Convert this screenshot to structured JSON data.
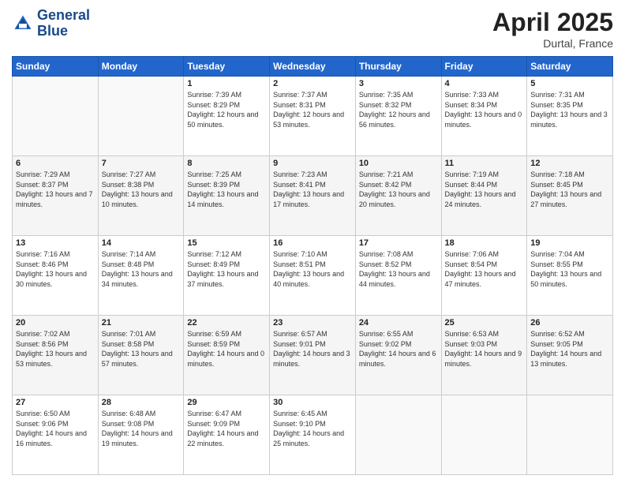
{
  "header": {
    "logo_line1": "General",
    "logo_line2": "Blue",
    "month": "April 2025",
    "location": "Durtal, France"
  },
  "weekdays": [
    "Sunday",
    "Monday",
    "Tuesday",
    "Wednesday",
    "Thursday",
    "Friday",
    "Saturday"
  ],
  "weeks": [
    [
      {
        "day": "",
        "info": ""
      },
      {
        "day": "",
        "info": ""
      },
      {
        "day": "1",
        "info": "Sunrise: 7:39 AM\nSunset: 8:29 PM\nDaylight: 12 hours and 50 minutes."
      },
      {
        "day": "2",
        "info": "Sunrise: 7:37 AM\nSunset: 8:31 PM\nDaylight: 12 hours and 53 minutes."
      },
      {
        "day": "3",
        "info": "Sunrise: 7:35 AM\nSunset: 8:32 PM\nDaylight: 12 hours and 56 minutes."
      },
      {
        "day": "4",
        "info": "Sunrise: 7:33 AM\nSunset: 8:34 PM\nDaylight: 13 hours and 0 minutes."
      },
      {
        "day": "5",
        "info": "Sunrise: 7:31 AM\nSunset: 8:35 PM\nDaylight: 13 hours and 3 minutes."
      }
    ],
    [
      {
        "day": "6",
        "info": "Sunrise: 7:29 AM\nSunset: 8:37 PM\nDaylight: 13 hours and 7 minutes."
      },
      {
        "day": "7",
        "info": "Sunrise: 7:27 AM\nSunset: 8:38 PM\nDaylight: 13 hours and 10 minutes."
      },
      {
        "day": "8",
        "info": "Sunrise: 7:25 AM\nSunset: 8:39 PM\nDaylight: 13 hours and 14 minutes."
      },
      {
        "day": "9",
        "info": "Sunrise: 7:23 AM\nSunset: 8:41 PM\nDaylight: 13 hours and 17 minutes."
      },
      {
        "day": "10",
        "info": "Sunrise: 7:21 AM\nSunset: 8:42 PM\nDaylight: 13 hours and 20 minutes."
      },
      {
        "day": "11",
        "info": "Sunrise: 7:19 AM\nSunset: 8:44 PM\nDaylight: 13 hours and 24 minutes."
      },
      {
        "day": "12",
        "info": "Sunrise: 7:18 AM\nSunset: 8:45 PM\nDaylight: 13 hours and 27 minutes."
      }
    ],
    [
      {
        "day": "13",
        "info": "Sunrise: 7:16 AM\nSunset: 8:46 PM\nDaylight: 13 hours and 30 minutes."
      },
      {
        "day": "14",
        "info": "Sunrise: 7:14 AM\nSunset: 8:48 PM\nDaylight: 13 hours and 34 minutes."
      },
      {
        "day": "15",
        "info": "Sunrise: 7:12 AM\nSunset: 8:49 PM\nDaylight: 13 hours and 37 minutes."
      },
      {
        "day": "16",
        "info": "Sunrise: 7:10 AM\nSunset: 8:51 PM\nDaylight: 13 hours and 40 minutes."
      },
      {
        "day": "17",
        "info": "Sunrise: 7:08 AM\nSunset: 8:52 PM\nDaylight: 13 hours and 44 minutes."
      },
      {
        "day": "18",
        "info": "Sunrise: 7:06 AM\nSunset: 8:54 PM\nDaylight: 13 hours and 47 minutes."
      },
      {
        "day": "19",
        "info": "Sunrise: 7:04 AM\nSunset: 8:55 PM\nDaylight: 13 hours and 50 minutes."
      }
    ],
    [
      {
        "day": "20",
        "info": "Sunrise: 7:02 AM\nSunset: 8:56 PM\nDaylight: 13 hours and 53 minutes."
      },
      {
        "day": "21",
        "info": "Sunrise: 7:01 AM\nSunset: 8:58 PM\nDaylight: 13 hours and 57 minutes."
      },
      {
        "day": "22",
        "info": "Sunrise: 6:59 AM\nSunset: 8:59 PM\nDaylight: 14 hours and 0 minutes."
      },
      {
        "day": "23",
        "info": "Sunrise: 6:57 AM\nSunset: 9:01 PM\nDaylight: 14 hours and 3 minutes."
      },
      {
        "day": "24",
        "info": "Sunrise: 6:55 AM\nSunset: 9:02 PM\nDaylight: 14 hours and 6 minutes."
      },
      {
        "day": "25",
        "info": "Sunrise: 6:53 AM\nSunset: 9:03 PM\nDaylight: 14 hours and 9 minutes."
      },
      {
        "day": "26",
        "info": "Sunrise: 6:52 AM\nSunset: 9:05 PM\nDaylight: 14 hours and 13 minutes."
      }
    ],
    [
      {
        "day": "27",
        "info": "Sunrise: 6:50 AM\nSunset: 9:06 PM\nDaylight: 14 hours and 16 minutes."
      },
      {
        "day": "28",
        "info": "Sunrise: 6:48 AM\nSunset: 9:08 PM\nDaylight: 14 hours and 19 minutes."
      },
      {
        "day": "29",
        "info": "Sunrise: 6:47 AM\nSunset: 9:09 PM\nDaylight: 14 hours and 22 minutes."
      },
      {
        "day": "30",
        "info": "Sunrise: 6:45 AM\nSunset: 9:10 PM\nDaylight: 14 hours and 25 minutes."
      },
      {
        "day": "",
        "info": ""
      },
      {
        "day": "",
        "info": ""
      },
      {
        "day": "",
        "info": ""
      }
    ]
  ]
}
